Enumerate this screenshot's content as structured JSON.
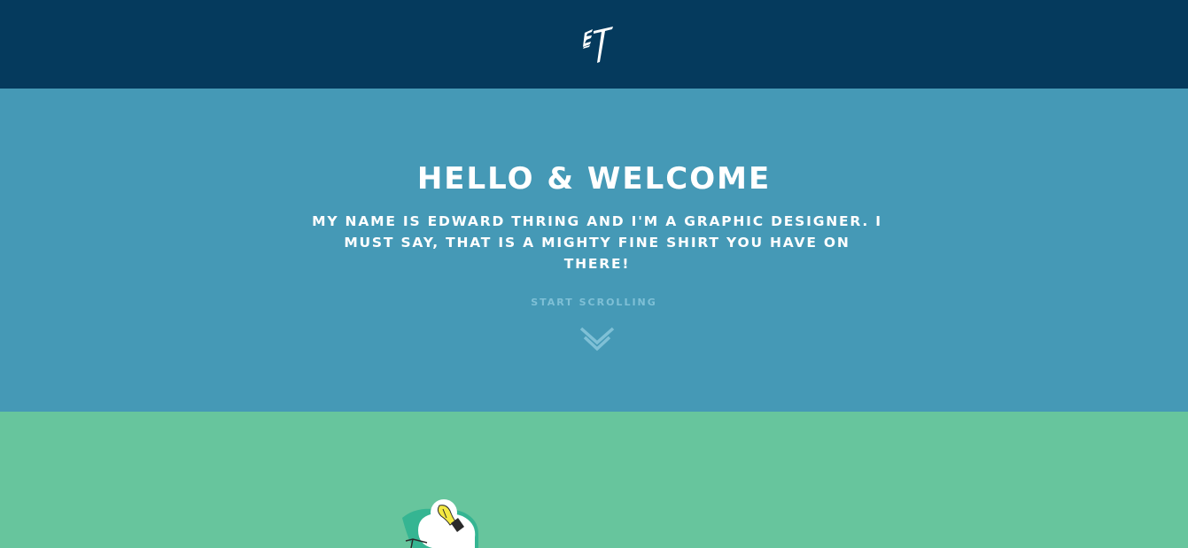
{
  "header": {
    "logo": "ET",
    "logo_icon": "et-monogram-logo",
    "background_color": "#053a5d"
  },
  "hero": {
    "title": "HELLO & WELCOME",
    "subtitle": "MY NAME IS EDWARD THRING AND I'M A GRAPHIC DESIGNER. I MUST SAY, THAT IS A MIGHTY FINE SHIRT YOU HAVE ON THERE!",
    "scroll_label": "START SCROLLING",
    "scroll_icon": "double-chevron-down-icon",
    "background_color": "#4599b6"
  },
  "section2": {
    "illustration_icon": "lightbulb-head-illustration",
    "background_color": "#67c59d"
  }
}
